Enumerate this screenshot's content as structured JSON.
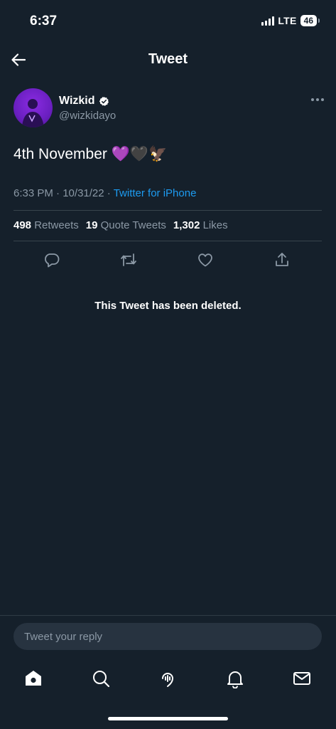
{
  "status_bar": {
    "time": "6:37",
    "network": "LTE",
    "battery": "46"
  },
  "header": {
    "title": "Tweet",
    "back_icon": "arrow-left-icon"
  },
  "tweet": {
    "author": {
      "display_name": "Wizkid",
      "handle": "@wizkidayo",
      "verified": true
    },
    "text": "4th November 💜🖤🦅",
    "time": "6:33 PM",
    "date": "10/31/22",
    "source": "Twitter for iPhone",
    "stats": [
      {
        "count": "498",
        "label": "Retweets"
      },
      {
        "count": "19",
        "label": "Quote Tweets"
      },
      {
        "count": "1,302",
        "label": "Likes"
      }
    ],
    "deleted_message": "This Tweet has been deleted."
  },
  "reply": {
    "placeholder": "Tweet your reply"
  },
  "tabbar": {
    "items": [
      "home-icon",
      "search-icon",
      "spaces-icon",
      "notifications-icon",
      "messages-icon"
    ]
  },
  "colors": {
    "background": "#15202b",
    "accent": "#1d9bf0",
    "secondary_text": "#8b98a5",
    "divider": "#38444d"
  }
}
